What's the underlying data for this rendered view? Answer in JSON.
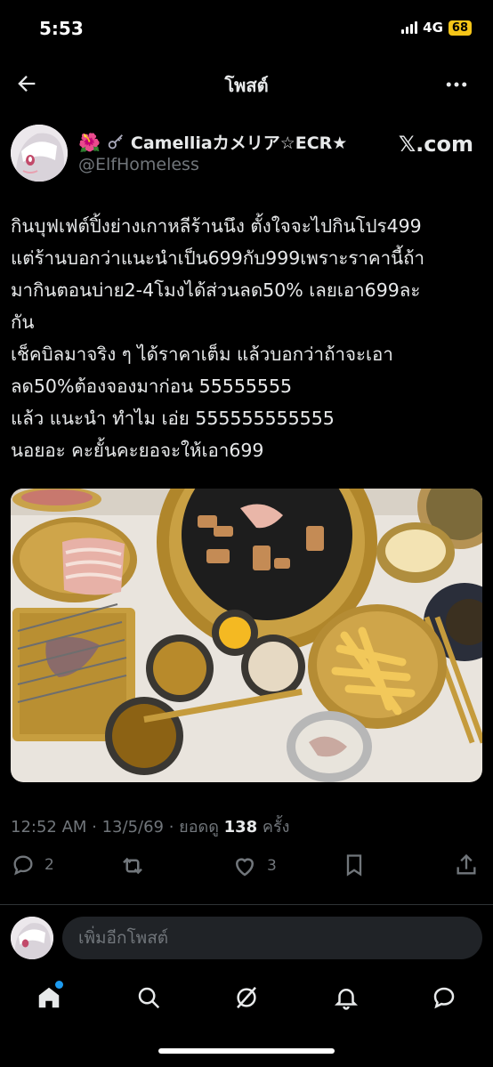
{
  "status_bar": {
    "time": "5:53",
    "network": "4G",
    "battery": "68"
  },
  "header": {
    "title": "โพสต์"
  },
  "author": {
    "name": "Camelliaカメリア☆ECR★",
    "handle": "@ElfHomeless",
    "badge": "𝕏.com",
    "icons": [
      "hibiscus-emoji",
      "key-emoji"
    ]
  },
  "post": {
    "text": "กินบุฟเฟต์ปิ้งย่างเกาหลีร้านนึง ตั้งใจจะไปกินโปร499\nแต่ร้านบอกว่าแนะนำเป็น699กับ999เพราะราคานี้ถ้า\nมากินตอนบ่าย2-4โมงได้ส่วนลด50% เลยเอา699ละ\nกัน\nเช็คบิลมาจริง ๆ ได้ราคาเต็ม แล้วบอกว่าถ้าจะเอา\nลด50%ต้องจองมาก่อน 55555555\nแล้ว แนะนำ ทำไม เอ่ย 555555555555\nนอยอะ คะยั้นคะยอจะให้เอา699",
    "time": "12:52 AM · 13/5/69 · ยอดดู ",
    "views": "138",
    "views_unit": " ครั้ง"
  },
  "actions": {
    "replies": "2",
    "likes": "3"
  },
  "reply_bar": {
    "placeholder": "เพิ่มอีกโพสต์"
  },
  "colors": {
    "background": "#000000",
    "text": "#e7e9ea",
    "muted": "#71767b",
    "accent": "#1d9bf0",
    "battery": "#f5c518"
  }
}
